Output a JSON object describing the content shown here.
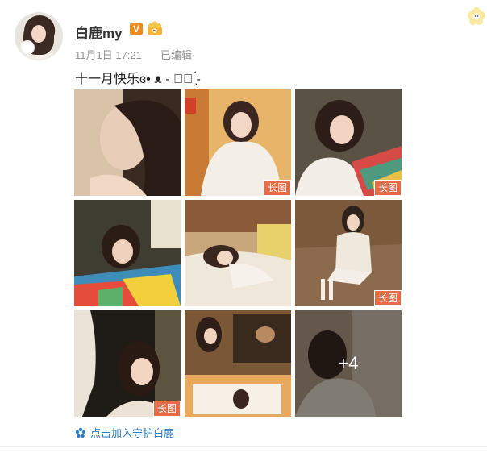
{
  "post": {
    "author": "白鹿my",
    "verified_label": "V",
    "time": "11月1日 17:21",
    "edited": "已编辑",
    "text": "十一月快乐ɞ• ᴥ - ძ⃝ ̖́-",
    "more_count": "+4",
    "long_label": "长图",
    "guard_link": "点击加入守护白鹿"
  },
  "colors": {
    "link": "#2a7dbf",
    "badge": "#e86b45",
    "vip": "#f08a1c"
  },
  "icons": [
    "flower-icon",
    "crown-icon",
    "verified-icon",
    "guard-icon"
  ]
}
